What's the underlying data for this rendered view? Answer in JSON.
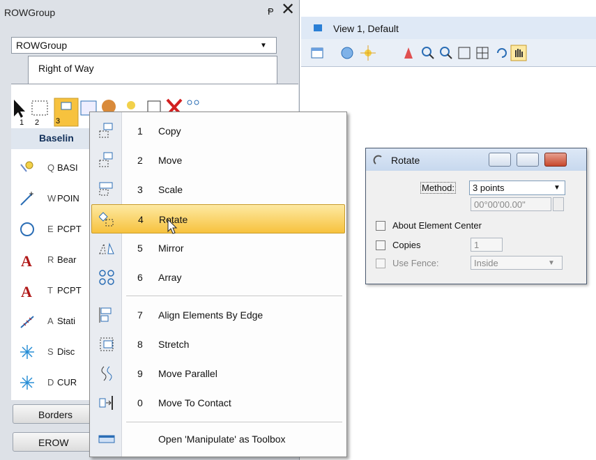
{
  "left_panel": {
    "title": "ROWGroup",
    "pin_glyph": "Ᵽ",
    "close_glyph": "✕",
    "group_select_value": "ROWGroup",
    "active_tab": "Right of Way",
    "section_header": "Baselin",
    "list": [
      {
        "key": "Q",
        "text": "BASI",
        "icon": "placemark-icon"
      },
      {
        "key": "W",
        "text": "POIN",
        "icon": "point-line-icon"
      },
      {
        "key": "E",
        "text": "PCPT",
        "icon": "circle-icon"
      },
      {
        "key": "R",
        "text": "Bear",
        "icon": "text-a-icon"
      },
      {
        "key": "T",
        "text": "PCPT",
        "icon": "text-a-icon"
      },
      {
        "key": "A",
        "text": "Stati",
        "icon": "station-icon"
      },
      {
        "key": "S",
        "text": "Disc",
        "icon": "discontinuity-icon"
      },
      {
        "key": "D",
        "text": "CUR",
        "icon": "curve-icon"
      }
    ],
    "bottom_buttons": [
      "Borders",
      "EROW"
    ]
  },
  "view": {
    "title": "View 1, Default"
  },
  "rotate_dialog": {
    "title": "Rotate",
    "method_label": "Method:",
    "method_value": "3 points",
    "angle_value": "00°00'00.00\"",
    "about_center_label": "About Element Center",
    "copies_label": "Copies",
    "copies_value": "1",
    "use_fence_label": "Use Fence:",
    "fence_value": "Inside"
  },
  "context_menu": {
    "items": [
      {
        "num": "1",
        "label": "Copy"
      },
      {
        "num": "2",
        "label": "Move"
      },
      {
        "num": "3",
        "label": "Scale"
      },
      {
        "num": "4",
        "label": "Rotate"
      },
      {
        "num": "5",
        "label": "Mirror"
      },
      {
        "num": "6",
        "label": "Array"
      },
      {
        "num": "7",
        "label": "Align Elements By Edge"
      },
      {
        "num": "8",
        "label": "Stretch"
      },
      {
        "num": "9",
        "label": "Move Parallel"
      },
      {
        "num": "0",
        "label": "Move To Contact"
      }
    ],
    "open_toolbox": "Open 'Manipulate' as Toolbox",
    "highlighted": "Rotate",
    "highlight_color": "#f7c23e"
  }
}
